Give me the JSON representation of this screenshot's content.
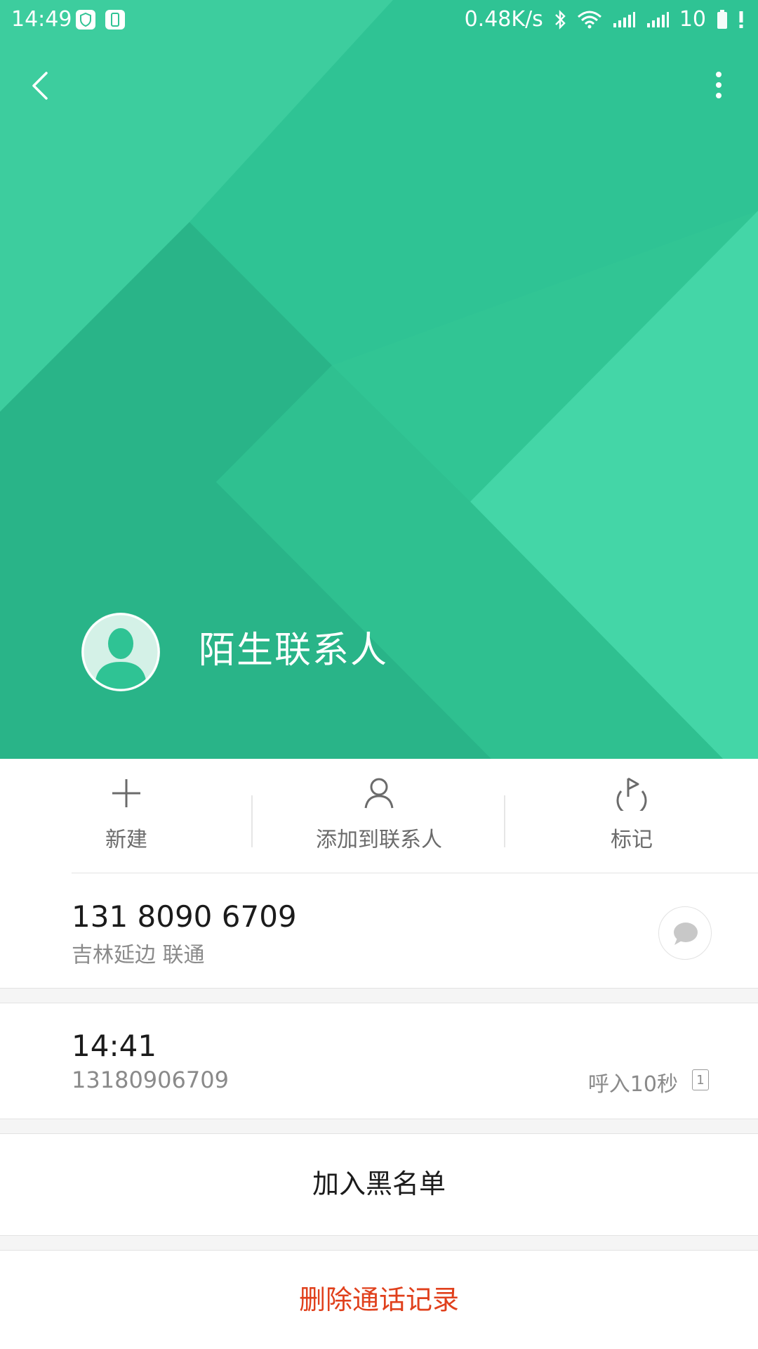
{
  "status_bar": {
    "time": "14:49",
    "net_speed": "0.48K/s",
    "battery_level": "10",
    "left_icons": [
      "shield-icon",
      "phone-device-icon"
    ],
    "right_icons": [
      "bluetooth-icon",
      "wifi-icon",
      "signal-icon",
      "signal-icon",
      "battery-icon",
      "alert-icon"
    ]
  },
  "header": {
    "back_icon": "chevron-left-icon",
    "more_icon": "more-vertical-icon",
    "contact_name": "陌生联系人",
    "colors": {
      "primary": "#2fc596",
      "light": "#44d4a6",
      "dark": "#27b487"
    }
  },
  "actions": [
    {
      "label": "新建",
      "icon": "plus-icon"
    },
    {
      "label": "添加到联系人",
      "icon": "person-icon"
    },
    {
      "label": "标记",
      "icon": "flag-icon"
    }
  ],
  "phone": {
    "number": "131 8090 6709",
    "location": "吉林延边 联通",
    "message_icon": "message-bubble-icon"
  },
  "call_log": {
    "time": "14:41",
    "number": "13180906709",
    "type": "呼入10秒",
    "sim": "1"
  },
  "buttons": {
    "blacklist": "加入黑名单",
    "delete": "删除通话记录",
    "delete_color": "#e0401c"
  }
}
